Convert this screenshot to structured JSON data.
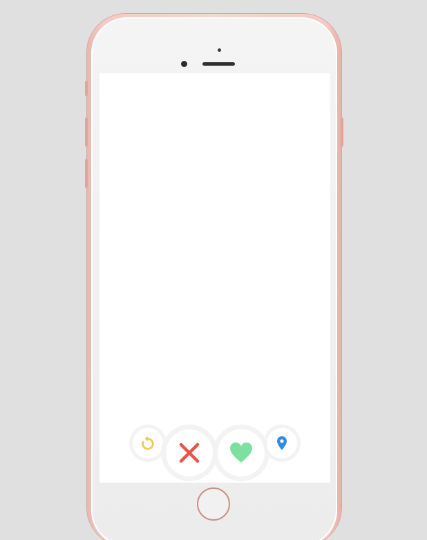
{
  "device": {
    "model": "iphone",
    "finish_color": "#f3cbc4",
    "face_color": "#f2f2f2"
  },
  "screen": {
    "background": "#ffffff",
    "content": ""
  },
  "actions": {
    "undo": {
      "icon": "undo-icon",
      "color": "#f2c94c"
    },
    "nope": {
      "icon": "close-x-icon",
      "color": "#e8534a"
    },
    "like": {
      "icon": "heart-icon",
      "color": "#7ee0a0"
    },
    "location": {
      "icon": "location-pin-icon",
      "color": "#2f8de4"
    }
  }
}
